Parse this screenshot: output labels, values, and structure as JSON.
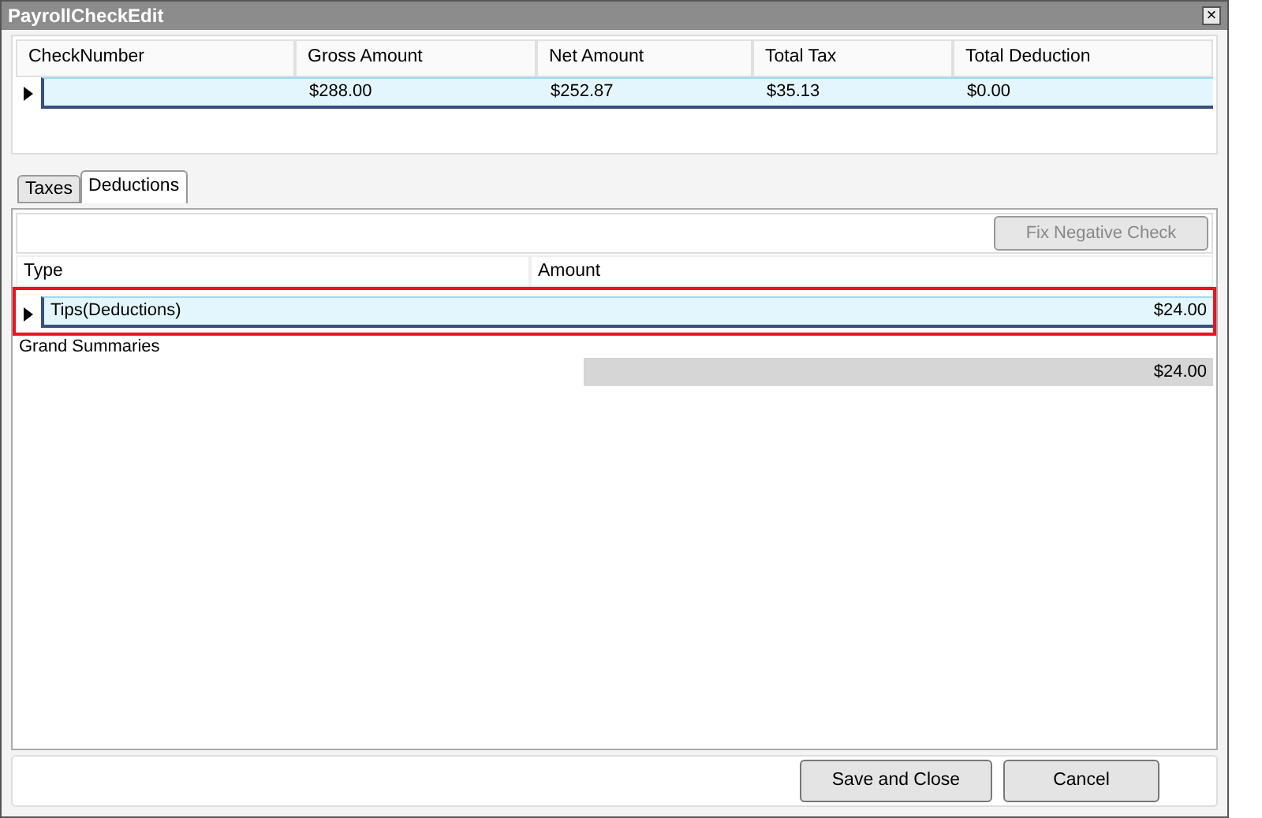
{
  "window": {
    "title": "PayrollCheckEdit",
    "close_glyph": "×"
  },
  "check_grid": {
    "columns": [
      "CheckNumber",
      "Gross Amount",
      "Net Amount",
      "Total Tax",
      "Total Deduction"
    ],
    "rows": [
      {
        "selected": true,
        "cells": [
          null,
          "$288.00",
          "$252.87",
          "$35.13",
          "$0.00"
        ]
      }
    ]
  },
  "tabs": [
    {
      "label": "Taxes",
      "selected": false
    },
    {
      "label": "Deductions",
      "selected": true
    }
  ],
  "fix_button": {
    "label": "Fix Negative Check",
    "disabled": true
  },
  "deductions_grid": {
    "columns": [
      "Type",
      "Amount"
    ],
    "rows": [
      {
        "selected": true,
        "highlighted": true,
        "cells": [
          "Tips(Deductions)",
          "$24.00"
        ]
      }
    ],
    "summary_label": "Grand Summaries",
    "summary_total": "$24.00"
  },
  "buttons": [
    "Save and Close",
    "Cancel"
  ]
}
